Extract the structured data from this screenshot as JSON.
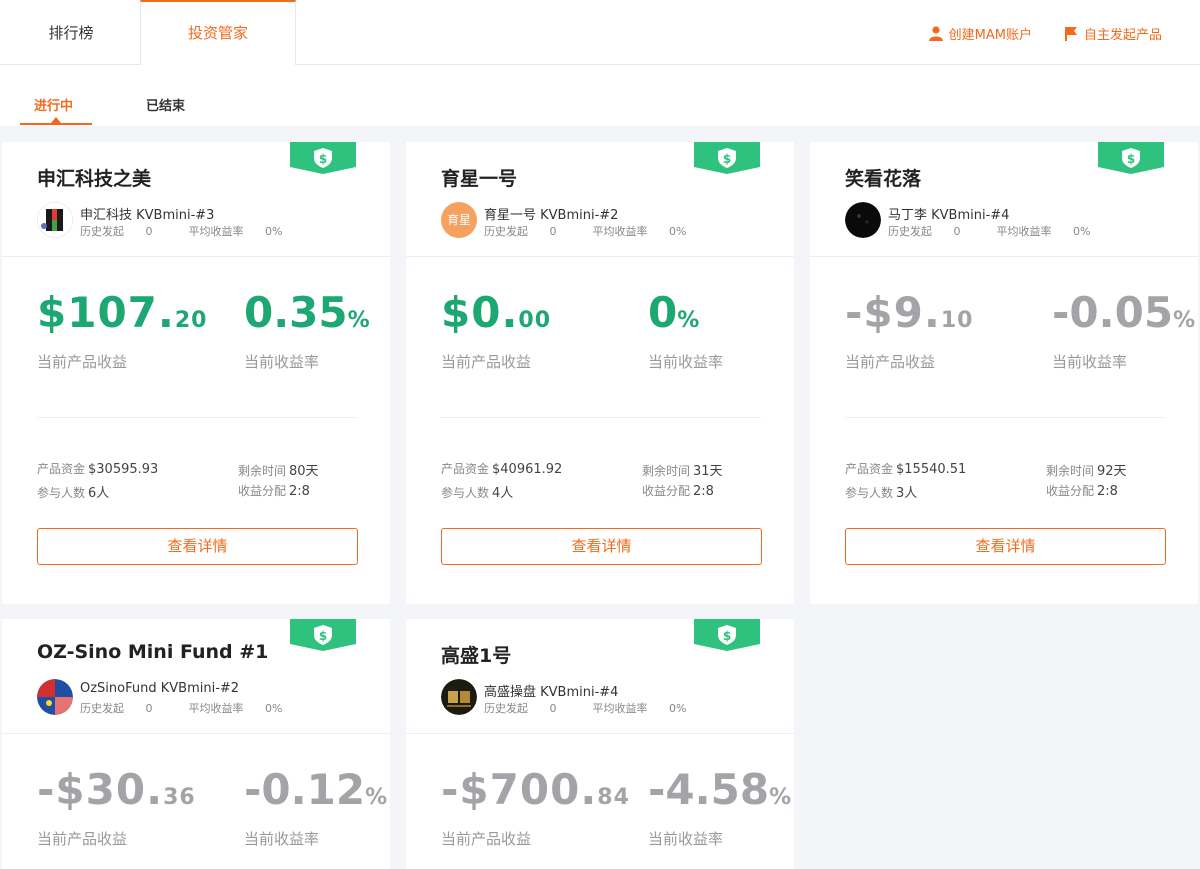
{
  "tabs": [
    {
      "label": "排行榜"
    },
    {
      "label": "投资管家"
    }
  ],
  "actions": {
    "create_mam": "创建MAM账户",
    "launch_product": "自主发起产品"
  },
  "subtabs": [
    {
      "label": "进行中"
    },
    {
      "label": "已结束"
    }
  ],
  "labels": {
    "history": "历史发起",
    "avg_rate": "平均收益率",
    "current_profit": "当前产品收益",
    "current_rate": "当前收益率",
    "capital": "产品资金",
    "remaining": "剩余时间",
    "participants": "参与人数",
    "split": "收益分配",
    "details_button": "查看详情"
  },
  "colors": {
    "accent": "#f26b1d",
    "positive": "#1da773",
    "neutral": "#a3a4a8",
    "ribbon": "#2ec27e"
  },
  "cards": [
    {
      "title": "申汇科技之美",
      "manager": "申汇科技 KVBmini-#3",
      "history": "0",
      "avg_rate": "0%",
      "amount_main": "$107.",
      "amount_dec": "20",
      "rate_main": "0.35",
      "rate_unit": "%",
      "capital": "$30595.93",
      "remaining": "80天",
      "participants": "6人",
      "split": "2:8",
      "trend": "positive",
      "avatar": "colored-logo"
    },
    {
      "title": "育星一号",
      "manager": "育星一号 KVBmini-#2",
      "history": "0",
      "avg_rate": "0%",
      "amount_main": "$0.",
      "amount_dec": "00",
      "rate_main": "0",
      "rate_unit": "%",
      "capital": "$40961.92",
      "remaining": "31天",
      "participants": "4人",
      "split": "2:8",
      "trend": "positive",
      "avatar": "text-avatar",
      "avatar_text": "育星"
    },
    {
      "title": "笑看花落",
      "manager": "马丁李 KVBmini-#4",
      "history": "0",
      "avg_rate": "0%",
      "amount_main": "-$9.",
      "amount_dec": "10",
      "rate_main": "-0.05",
      "rate_unit": "%",
      "capital": "$15540.51",
      "remaining": "92天",
      "participants": "3人",
      "split": "2:8",
      "trend": "negative",
      "avatar": "dark-photo"
    },
    {
      "title": "OZ-Sino Mini Fund #1",
      "manager": "OzSinoFund KVBmini-#2",
      "history": "0",
      "avg_rate": "0%",
      "amount_main": "-$30.",
      "amount_dec": "36",
      "rate_main": "-0.12",
      "rate_unit": "%",
      "trend": "negative",
      "avatar": "flag-photo"
    },
    {
      "title": "高盛1号",
      "manager": "高盛操盘 KVBmini-#4",
      "history": "0",
      "avg_rate": "0%",
      "amount_main": "-$700.",
      "amount_dec": "84",
      "rate_main": "-4.58",
      "rate_unit": "%",
      "trend": "negative",
      "avatar": "gold-logo"
    }
  ]
}
